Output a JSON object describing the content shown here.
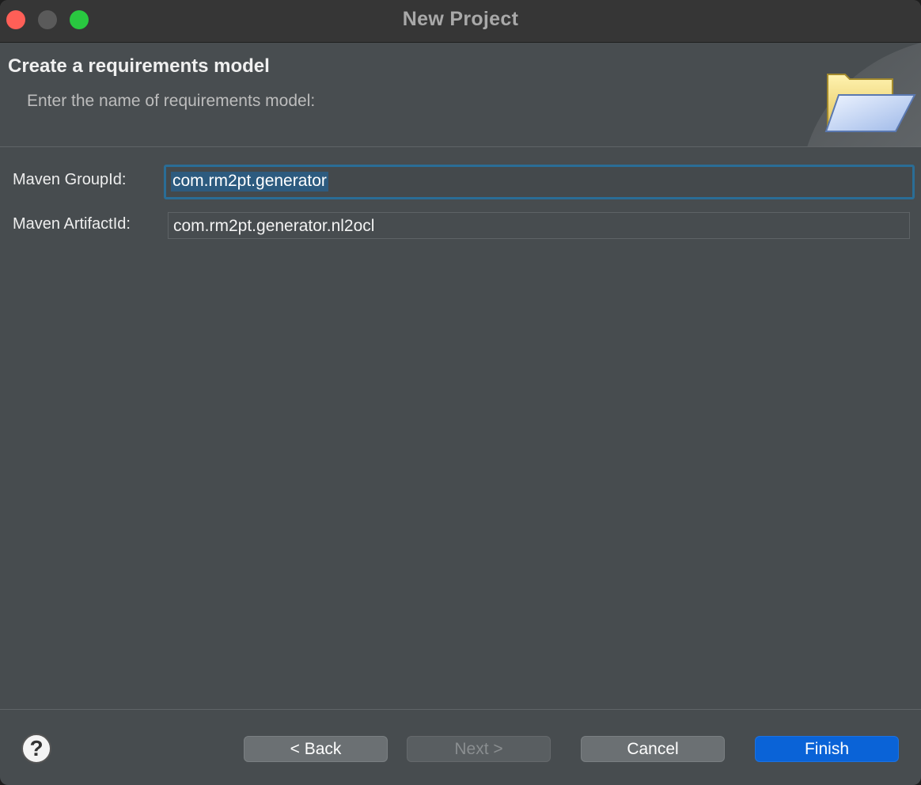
{
  "window": {
    "title": "New Project"
  },
  "banner": {
    "title": "Create a requirements model",
    "description": "Enter the name of requirements model:",
    "icon": "folder-open-icon"
  },
  "form": {
    "group_id_label": "Maven GroupId:",
    "group_id_value": "com.rm2pt.generator",
    "artifact_id_label": "Maven ArtifactId:",
    "artifact_id_value": "com.rm2pt.generator.nl2ocl"
  },
  "buttons": {
    "help": "?",
    "back": "< Back",
    "next": "Next >",
    "cancel": "Cancel",
    "finish": "Finish"
  },
  "colors": {
    "accent": "#0a63d7",
    "focus_ring": "#2a6d96",
    "traffic_close": "#fe5f57",
    "traffic_max": "#29c840"
  }
}
